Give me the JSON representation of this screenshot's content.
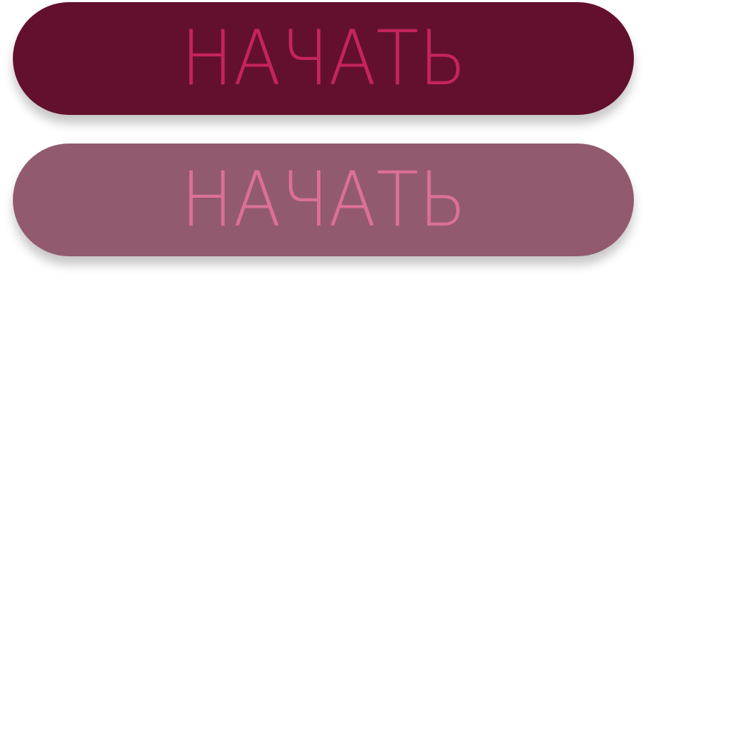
{
  "buttons": {
    "primary": {
      "label": "НАЧАТЬ",
      "background": "#63102E",
      "text_color": "#C5245E"
    },
    "secondary": {
      "label": "НАЧАТЬ",
      "background": "#925A6E",
      "text_color": "#DB7096"
    }
  }
}
